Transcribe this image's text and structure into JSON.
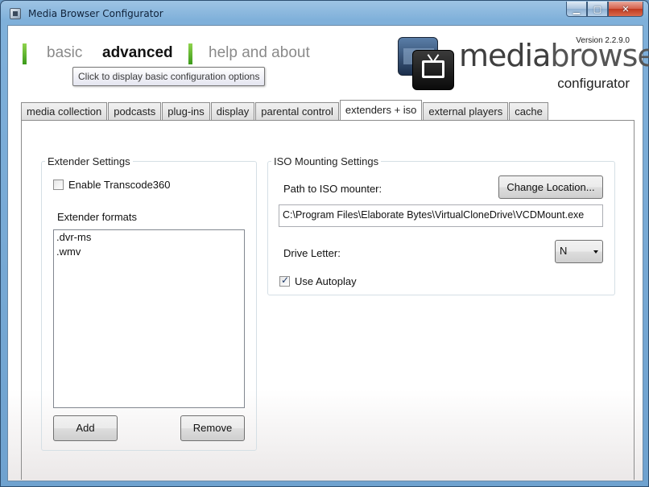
{
  "window": {
    "title": "Media Browser Configurator"
  },
  "nav": {
    "items": [
      {
        "label": "basic",
        "active": false
      },
      {
        "label": "advanced",
        "active": true
      },
      {
        "label": "help and about",
        "active": false
      }
    ],
    "tooltip": "Click to display basic configuration options"
  },
  "logo": {
    "version": "Version 2.2.9.0",
    "brand_part1": "media",
    "brand_part2": "browser",
    "subtitle": "configurator"
  },
  "tabs": [
    {
      "label": "media collection",
      "active": false
    },
    {
      "label": "podcasts",
      "active": false
    },
    {
      "label": "plug-ins",
      "active": false
    },
    {
      "label": "display",
      "active": false
    },
    {
      "label": "parental control",
      "active": false
    },
    {
      "label": "extenders + iso",
      "active": true
    },
    {
      "label": "external players",
      "active": false
    },
    {
      "label": "cache",
      "active": false
    }
  ],
  "extender": {
    "legend": "Extender Settings",
    "enable_transcode_label": "Enable Transcode360",
    "enable_transcode_checked": false,
    "formats_label": "Extender formats",
    "formats": [
      ".dvr-ms",
      ".wmv"
    ],
    "add_label": "Add",
    "remove_label": "Remove"
  },
  "iso": {
    "legend": "ISO Mounting Settings",
    "path_label": "Path to ISO mounter:",
    "change_location_label": "Change Location...",
    "path_value": "C:\\Program Files\\Elaborate Bytes\\VirtualCloneDrive\\VCDMount.exe",
    "drive_letter_label": "Drive Letter:",
    "drive_letter_value": "N",
    "autoplay_label": "Use Autoplay",
    "autoplay_checked": true
  },
  "colors": {
    "nav_accent": "#4caf27",
    "frame": "#6fa2cf"
  }
}
